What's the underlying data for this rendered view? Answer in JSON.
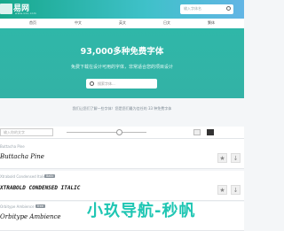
{
  "site": {
    "name": "易网",
    "tagline": "www.xxx.com"
  },
  "header": {
    "search_placeholder": "输入字体名"
  },
  "nav": [
    "首页",
    "中文",
    "英文",
    "日文",
    "繁体"
  ],
  "hero": {
    "title": "93,000多种免费字体",
    "subtitle": "免费下载在设计可用的字体，非常适合您的项目设计",
    "search_placeholder": "搜索字体..."
  },
  "info": "我们让您们了解一些字体！您是您们最为信任的 33 种免费字体",
  "toolbar": {
    "preview_placeholder": "输入你的文字"
  },
  "fonts": [
    {
      "name": "Buttacha Pine",
      "preview": "Buttacha Pine",
      "badge": ""
    },
    {
      "name": "Xtrabold Condensed Italic",
      "preview": "XTRABOLD CONDENSED ITALIC",
      "badge": "Italic"
    },
    {
      "name": "Orbitype Ambience",
      "preview": "Orbitype Ambience",
      "badge": "free"
    }
  ],
  "watermark": "小玖导航-秒帆"
}
